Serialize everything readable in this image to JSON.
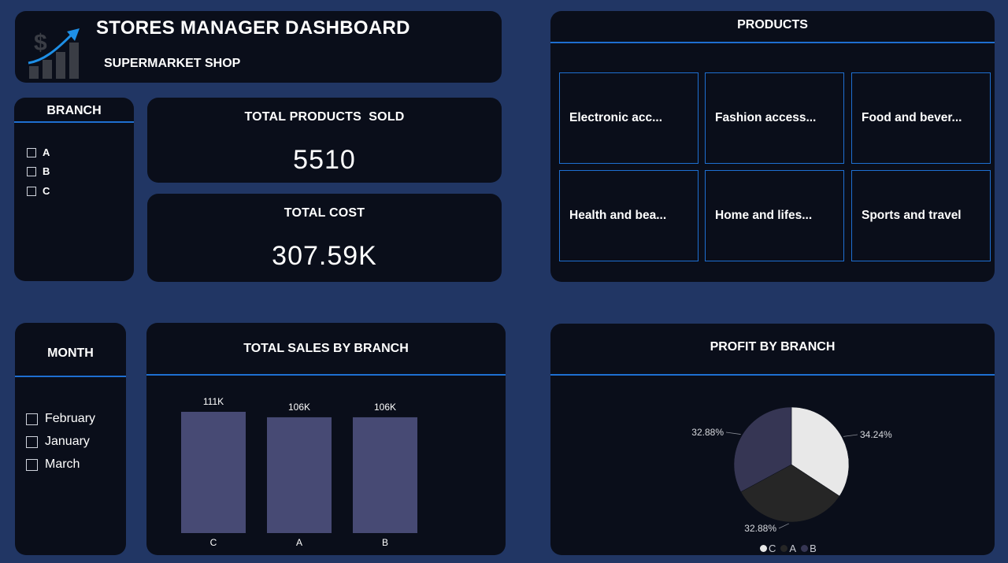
{
  "header": {
    "title": "STORES MANAGER DASHBOARD",
    "subtitle": "SUPERMARKET SHOP",
    "logo_icon": "growth-dollar-icon"
  },
  "branch_slicer": {
    "title": "BRANCH",
    "options": [
      "A",
      "B",
      "C"
    ]
  },
  "kpis": {
    "products_sold": {
      "label": "TOTAL PRODUCTS  SOLD",
      "value": "5510"
    },
    "total_cost": {
      "label": "TOTAL COST",
      "value": "307.59K"
    }
  },
  "products": {
    "title": "PRODUCTS",
    "tiles": [
      "Electronic acc...",
      "Fashion access...",
      "Food and bever...",
      "Health and bea...",
      "Home and lifes...",
      "Sports and travel"
    ]
  },
  "month_slicer": {
    "title": "MONTH",
    "options": [
      "February",
      "January",
      "March"
    ]
  },
  "sales_chart": {
    "title": "TOTAL SALES BY BRANCH",
    "data_labels": [
      "111K",
      "106K",
      "106K"
    ],
    "chart_data": {
      "type": "bar",
      "categories": [
        "C",
        "A",
        "B"
      ],
      "values": [
        111,
        106,
        106
      ],
      "ylim": [
        0,
        111
      ],
      "grid": false,
      "bar_color": "#474a74"
    }
  },
  "profit_chart": {
    "title": "PROFIT BY BRANCH",
    "slice_labels": [
      "34.24%",
      "32.88%",
      "32.88%"
    ],
    "legend": [
      "C",
      "A",
      "B"
    ],
    "chart_data": {
      "type": "pie",
      "categories": [
        "C",
        "A",
        "B"
      ],
      "values": [
        34.24,
        32.88,
        32.88
      ],
      "colors": [
        "#e8e8e8",
        "#262626",
        "#363654"
      ],
      "legend_position": "bottom"
    }
  },
  "colors": {
    "background": "#213664",
    "card": "#0a0e1a",
    "accent": "#1e6fd1"
  }
}
